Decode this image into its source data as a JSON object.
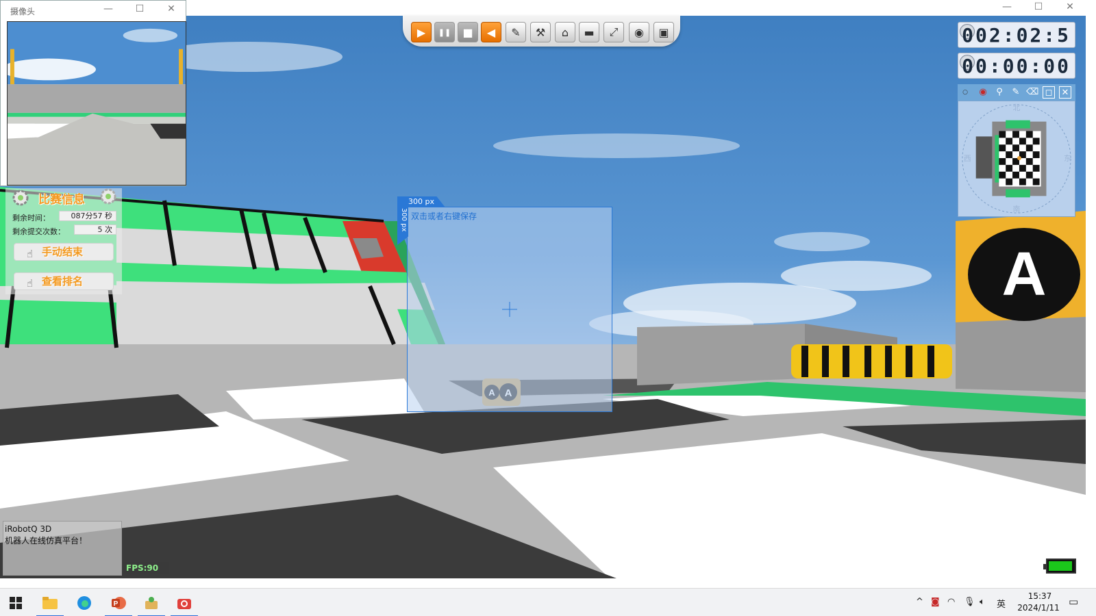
{
  "camera_window": {
    "title": "摄像头"
  },
  "toolbar": {
    "buttons": [
      {
        "name": "play-button",
        "glyph": "▶",
        "style": "orange"
      },
      {
        "name": "pause-button",
        "glyph": "❚❚",
        "style": "gray"
      },
      {
        "name": "stop-button",
        "glyph": "■",
        "style": "gray"
      },
      {
        "name": "back-button",
        "glyph": "◀",
        "style": "orange"
      },
      {
        "name": "edit-button",
        "glyph": "✎",
        "style": "normal"
      },
      {
        "name": "tools-button",
        "glyph": "⚒",
        "style": "normal"
      },
      {
        "name": "terrain-button",
        "glyph": "⌂",
        "style": "normal"
      },
      {
        "name": "camera-follow-button",
        "glyph": "▬",
        "style": "normal"
      },
      {
        "name": "fullscreen-button",
        "glyph": "⤢",
        "style": "normal"
      },
      {
        "name": "record-button",
        "glyph": "◉",
        "style": "normal"
      },
      {
        "name": "video-button",
        "glyph": "▣",
        "style": "normal"
      }
    ]
  },
  "timers": {
    "elapsed": "002:02:5",
    "countdown": "00:00:00"
  },
  "match_info": {
    "title": "比赛信息",
    "remaining_time_label": "剩余时间：",
    "remaining_time_value": "087分57 秒",
    "remaining_submissions_label": "剩余提交次数：",
    "remaining_submissions_value": "5 次",
    "end_button": "手动结束",
    "ranking_button": "查看排名"
  },
  "screenshot": {
    "width_label": "300 px",
    "height_label": "300 px",
    "hint": "双击或者右键保存"
  },
  "scene_sign": {
    "letter": "A"
  },
  "brand": {
    "name": "iRobotQ 3D",
    "slogan": "机器人在线仿真平台！"
  },
  "fps": "FPS:90",
  "battery": {
    "level": 0.95,
    "color": "#1bc61b"
  },
  "minimap": {
    "north": "北",
    "south": "南",
    "east": "东",
    "west": "西"
  },
  "taskbar": {
    "ime": "英",
    "time": "15:37",
    "date": "2024/1/11"
  }
}
